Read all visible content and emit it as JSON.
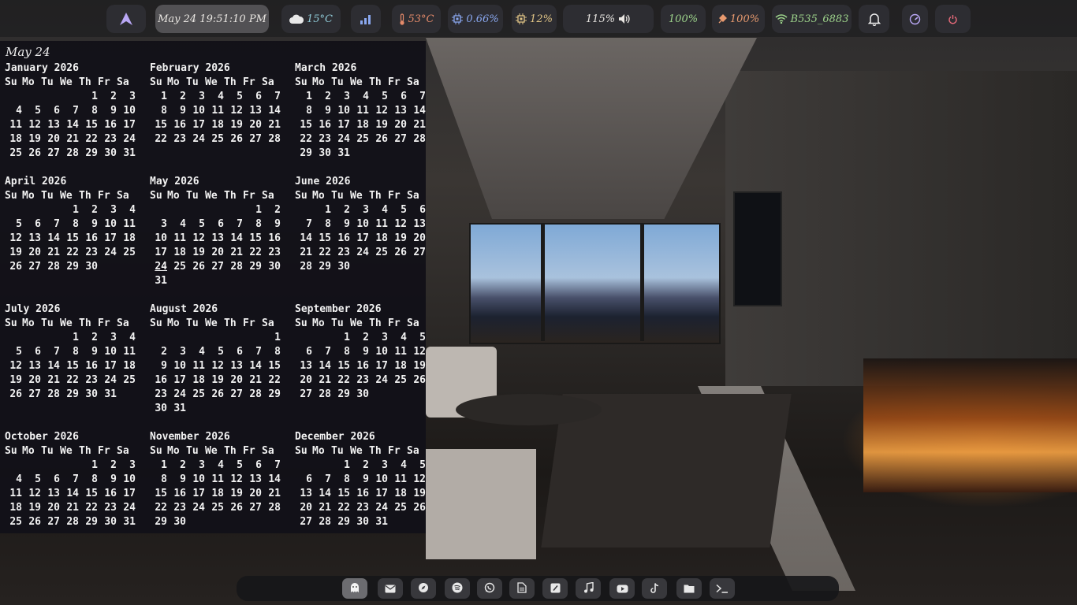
{
  "topbar": {
    "datetime": "May 24 19:51:10 PM",
    "weather": "15°C",
    "temperature": "53°C",
    "cpu": "0.66%",
    "memory": "12%",
    "volume": "115%",
    "brightness": "100%",
    "battery": "100%",
    "wifi": "B535_6883",
    "colors": {
      "weather": "#8fc9d6",
      "temperature": "#e48a6a",
      "cpu": "#8aa8f0",
      "memory": "#e0c486",
      "brightness": "#9dd38b",
      "battery": "#e89a6f",
      "wifi": "#9dd38b",
      "power": "#e86a7a",
      "launcher": "#b9a7f5"
    }
  },
  "calendar": {
    "title": "May 24",
    "weekday_header": [
      "Su",
      "Mo",
      "Tu",
      "We",
      "Th",
      "Fr",
      "Sa"
    ],
    "today": {
      "month": 4,
      "day": 24
    },
    "months": [
      {
        "name": "January 2026",
        "weeks": [
          [
            "",
            "",
            "",
            "",
            "1",
            "2",
            "3"
          ],
          [
            "4",
            "5",
            "6",
            "7",
            "8",
            "9",
            "10"
          ],
          [
            "11",
            "12",
            "13",
            "14",
            "15",
            "16",
            "17"
          ],
          [
            "18",
            "19",
            "20",
            "21",
            "22",
            "23",
            "24"
          ],
          [
            "25",
            "26",
            "27",
            "28",
            "29",
            "30",
            "31"
          ]
        ]
      },
      {
        "name": "February 2026",
        "weeks": [
          [
            "1",
            "2",
            "3",
            "4",
            "5",
            "6",
            "7"
          ],
          [
            "8",
            "9",
            "10",
            "11",
            "12",
            "13",
            "14"
          ],
          [
            "15",
            "16",
            "17",
            "18",
            "19",
            "20",
            "21"
          ],
          [
            "22",
            "23",
            "24",
            "25",
            "26",
            "27",
            "28"
          ]
        ]
      },
      {
        "name": "March 2026",
        "weeks": [
          [
            "1",
            "2",
            "3",
            "4",
            "5",
            "6",
            "7"
          ],
          [
            "8",
            "9",
            "10",
            "11",
            "12",
            "13",
            "14"
          ],
          [
            "15",
            "16",
            "17",
            "18",
            "19",
            "20",
            "21"
          ],
          [
            "22",
            "23",
            "24",
            "25",
            "26",
            "27",
            "28"
          ],
          [
            "29",
            "30",
            "31",
            "",
            "",
            "",
            ""
          ]
        ]
      },
      {
        "name": "April 2026",
        "weeks": [
          [
            "",
            "",
            "",
            "1",
            "2",
            "3",
            "4"
          ],
          [
            "5",
            "6",
            "7",
            "8",
            "9",
            "10",
            "11"
          ],
          [
            "12",
            "13",
            "14",
            "15",
            "16",
            "17",
            "18"
          ],
          [
            "19",
            "20",
            "21",
            "22",
            "23",
            "24",
            "25"
          ],
          [
            "26",
            "27",
            "28",
            "29",
            "30",
            "",
            ""
          ]
        ]
      },
      {
        "name": "May 2026",
        "weeks": [
          [
            "",
            "",
            "",
            "",
            "",
            "1",
            "2"
          ],
          [
            "3",
            "4",
            "5",
            "6",
            "7",
            "8",
            "9"
          ],
          [
            "10",
            "11",
            "12",
            "13",
            "14",
            "15",
            "16"
          ],
          [
            "17",
            "18",
            "19",
            "20",
            "21",
            "22",
            "23"
          ],
          [
            "24",
            "25",
            "26",
            "27",
            "28",
            "29",
            "30"
          ],
          [
            "31",
            "",
            "",
            "",
            "",
            "",
            ""
          ]
        ]
      },
      {
        "name": "June 2026",
        "weeks": [
          [
            "",
            "1",
            "2",
            "3",
            "4",
            "5",
            "6"
          ],
          [
            "7",
            "8",
            "9",
            "10",
            "11",
            "12",
            "13"
          ],
          [
            "14",
            "15",
            "16",
            "17",
            "18",
            "19",
            "20"
          ],
          [
            "21",
            "22",
            "23",
            "24",
            "25",
            "26",
            "27"
          ],
          [
            "28",
            "29",
            "30",
            "",
            "",
            "",
            ""
          ]
        ]
      },
      {
        "name": "July 2026",
        "weeks": [
          [
            "",
            "",
            "",
            "1",
            "2",
            "3",
            "4"
          ],
          [
            "5",
            "6",
            "7",
            "8",
            "9",
            "10",
            "11"
          ],
          [
            "12",
            "13",
            "14",
            "15",
            "16",
            "17",
            "18"
          ],
          [
            "19",
            "20",
            "21",
            "22",
            "23",
            "24",
            "25"
          ],
          [
            "26",
            "27",
            "28",
            "29",
            "30",
            "31",
            ""
          ]
        ]
      },
      {
        "name": "August 2026",
        "weeks": [
          [
            "",
            "",
            "",
            "",
            "",
            "",
            "1"
          ],
          [
            "2",
            "3",
            "4",
            "5",
            "6",
            "7",
            "8"
          ],
          [
            "9",
            "10",
            "11",
            "12",
            "13",
            "14",
            "15"
          ],
          [
            "16",
            "17",
            "18",
            "19",
            "20",
            "21",
            "22"
          ],
          [
            "23",
            "24",
            "25",
            "26",
            "27",
            "28",
            "29"
          ],
          [
            "30",
            "31",
            "",
            "",
            "",
            "",
            ""
          ]
        ]
      },
      {
        "name": "September 2026",
        "weeks": [
          [
            "",
            "",
            "1",
            "2",
            "3",
            "4",
            "5"
          ],
          [
            "6",
            "7",
            "8",
            "9",
            "10",
            "11",
            "12"
          ],
          [
            "13",
            "14",
            "15",
            "16",
            "17",
            "18",
            "19"
          ],
          [
            "20",
            "21",
            "22",
            "23",
            "24",
            "25",
            "26"
          ],
          [
            "27",
            "28",
            "29",
            "30",
            "",
            "",
            ""
          ]
        ]
      },
      {
        "name": "October 2026",
        "weeks": [
          [
            "",
            "",
            "",
            "",
            "1",
            "2",
            "3"
          ],
          [
            "4",
            "5",
            "6",
            "7",
            "8",
            "9",
            "10"
          ],
          [
            "11",
            "12",
            "13",
            "14",
            "15",
            "16",
            "17"
          ],
          [
            "18",
            "19",
            "20",
            "21",
            "22",
            "23",
            "24"
          ],
          [
            "25",
            "26",
            "27",
            "28",
            "29",
            "30",
            "31"
          ]
        ]
      },
      {
        "name": "November 2026",
        "weeks": [
          [
            "1",
            "2",
            "3",
            "4",
            "5",
            "6",
            "7"
          ],
          [
            "8",
            "9",
            "10",
            "11",
            "12",
            "13",
            "14"
          ],
          [
            "15",
            "16",
            "17",
            "18",
            "19",
            "20",
            "21"
          ],
          [
            "22",
            "23",
            "24",
            "25",
            "26",
            "27",
            "28"
          ],
          [
            "29",
            "30",
            "",
            "",
            "",
            "",
            ""
          ]
        ]
      },
      {
        "name": "December 2026",
        "weeks": [
          [
            "",
            "",
            "1",
            "2",
            "3",
            "4",
            "5"
          ],
          [
            "6",
            "7",
            "8",
            "9",
            "10",
            "11",
            "12"
          ],
          [
            "13",
            "14",
            "15",
            "16",
            "17",
            "18",
            "19"
          ],
          [
            "20",
            "21",
            "22",
            "23",
            "24",
            "25",
            "26"
          ],
          [
            "27",
            "28",
            "29",
            "30",
            "31",
            "",
            ""
          ]
        ]
      }
    ]
  },
  "dock": {
    "items": [
      {
        "icon": "ghost-icon",
        "active": true
      },
      {
        "icon": "mail-icon",
        "active": false
      },
      {
        "icon": "compass-icon",
        "active": false
      },
      {
        "icon": "spotify-icon",
        "active": false
      },
      {
        "icon": "whatsapp-icon",
        "active": false
      },
      {
        "icon": "document-icon",
        "active": false
      },
      {
        "icon": "notes-icon",
        "active": false
      },
      {
        "icon": "music-note-icon",
        "active": false
      },
      {
        "icon": "youtube-icon",
        "active": false
      },
      {
        "icon": "tiktok-icon",
        "active": false
      },
      {
        "icon": "folder-icon",
        "active": false
      },
      {
        "icon": "terminal-icon",
        "active": false
      }
    ]
  }
}
